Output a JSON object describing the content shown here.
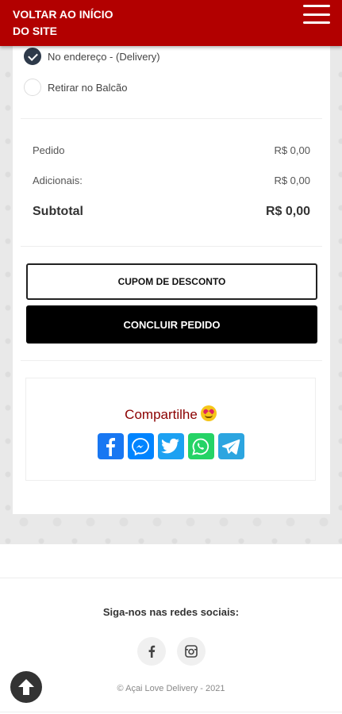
{
  "header": {
    "back_label": "VOLTAR AO INÍCIO DO SITE",
    "menu_icon": "hamburger-menu-icon",
    "bg_color": "#b20000"
  },
  "delivery_options": [
    {
      "label": "No endereço - (Delivery)",
      "checked": true
    },
    {
      "label": "Retirar no Balcão",
      "checked": false
    }
  ],
  "summary": {
    "pedido_label": "Pedido",
    "pedido_value": "R$ 0,00",
    "adicionais_label": "Adicionais:",
    "adicionais_value": "R$ 0,00",
    "subtotal_label": "Subtotal",
    "subtotal_value": "R$ 0,00"
  },
  "buttons": {
    "coupon": "CUPOM DE DESCONTO",
    "finish": "CONCLUIR PEDIDO"
  },
  "share": {
    "title": "Compartilhe",
    "title_color": "#8b0000",
    "icons": [
      "facebook-icon",
      "messenger-icon",
      "twitter-icon",
      "whatsapp-icon",
      "telegram-icon"
    ]
  },
  "footer": {
    "follow_label": "Siga-nos nas redes sociais:",
    "social": [
      "facebook-icon",
      "instagram-icon"
    ],
    "copyright": "© Açai Love Delivery - 2021"
  }
}
